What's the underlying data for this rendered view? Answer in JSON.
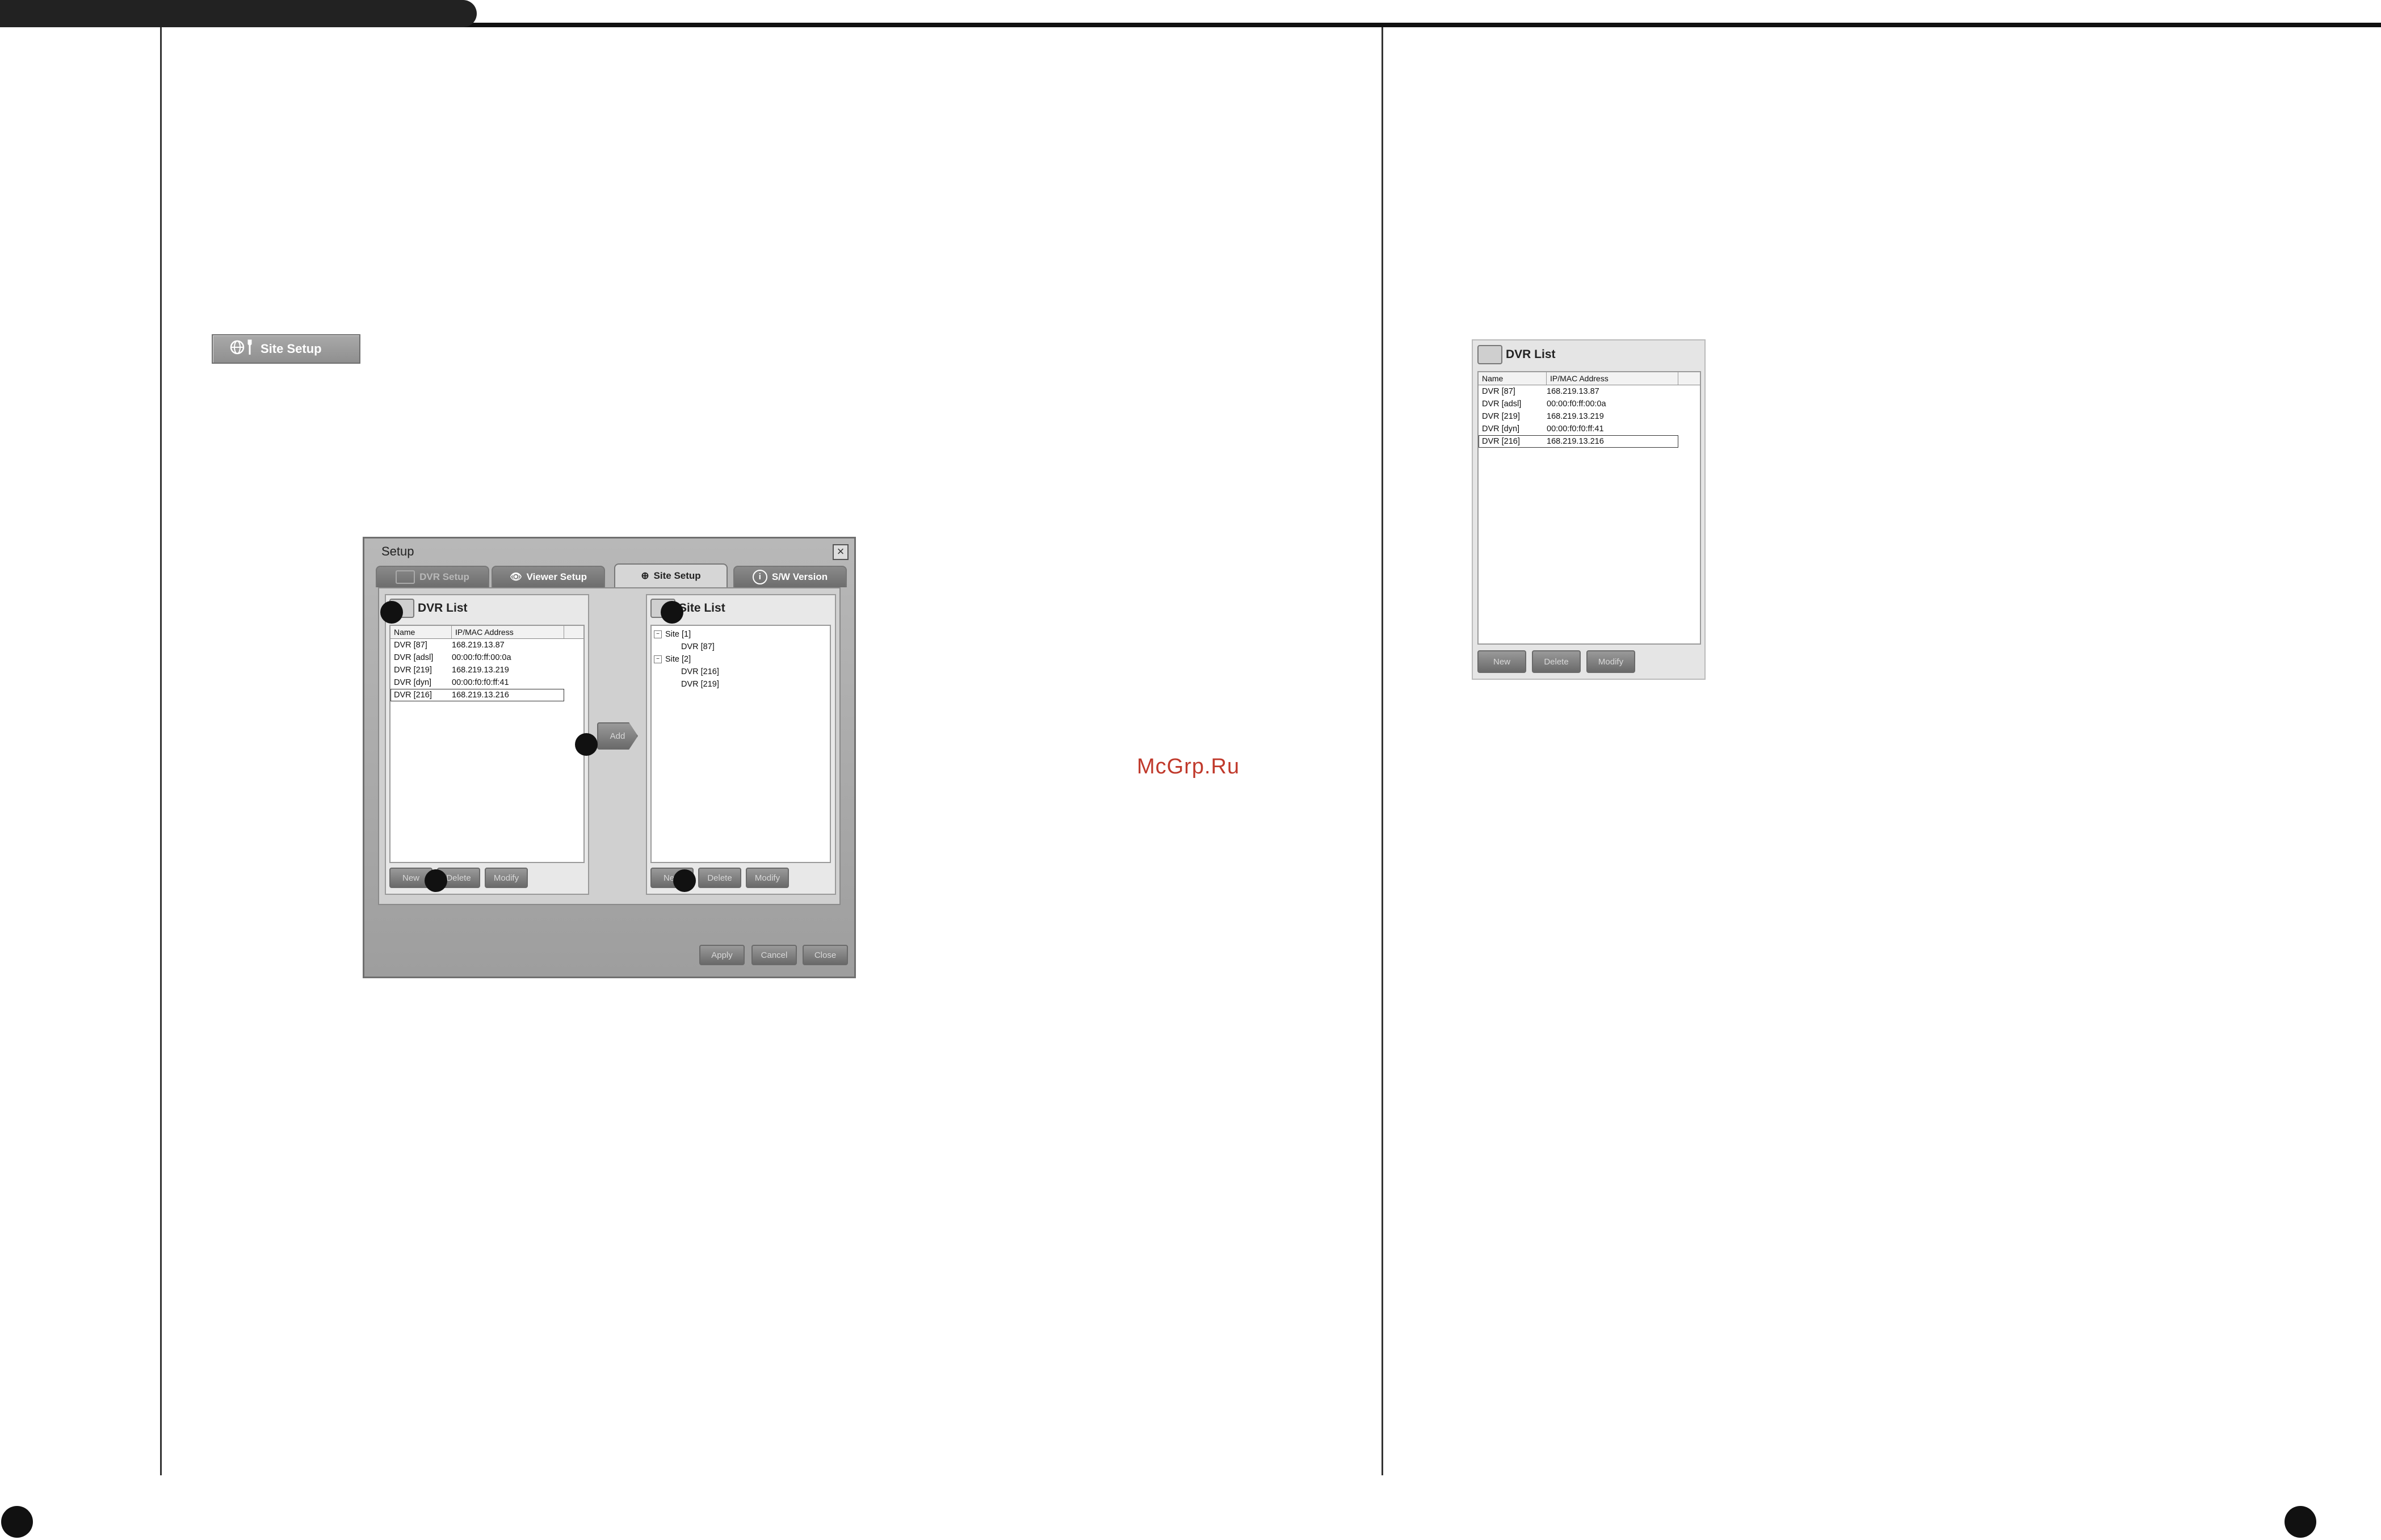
{
  "site_setup_button": {
    "label": "Site Setup",
    "icon": "globe-wrench-icon"
  },
  "dialog": {
    "title": "Setup",
    "close_icon": "close-icon",
    "tabs": [
      {
        "label": "DVR Setup",
        "icon": "dvr-icon",
        "state": "disabled"
      },
      {
        "label": "Viewer Setup",
        "icon": "eye-wrench-icon",
        "state": "normal"
      },
      {
        "label": "Site Setup",
        "icon": "globe-wrench-icon",
        "state": "active"
      },
      {
        "label": "S/W Version",
        "icon": "info-icon",
        "state": "normal"
      }
    ],
    "dvr_list": {
      "title": "DVR List",
      "columns": [
        "Name",
        "IP/MAC Address"
      ],
      "rows": [
        {
          "name": "DVR [87]",
          "address": "168.219.13.87"
        },
        {
          "name": "DVR [adsl]",
          "address": "00:00:f0:ff:00:0a"
        },
        {
          "name": "DVR [219]",
          "address": "168.219.13.219"
        },
        {
          "name": "DVR [dyn]",
          "address": "00:00:f0:f0:ff:41"
        },
        {
          "name": "DVR [216]",
          "address": "168.219.13.216"
        }
      ],
      "buttons": {
        "new": "New",
        "delete": "Delete",
        "modify": "Modify"
      }
    },
    "add_button": "Add",
    "site_list": {
      "title": "Site List",
      "tree": [
        {
          "label": "Site [1]",
          "children": [
            "DVR [87]"
          ]
        },
        {
          "label": "Site [2]",
          "children": [
            "DVR [216]",
            "DVR [219]"
          ]
        }
      ],
      "buttons": {
        "new": "New",
        "delete": "Delete",
        "modify": "Modify"
      }
    },
    "footer_buttons": {
      "apply": "Apply",
      "cancel": "Cancel",
      "close": "Close"
    }
  },
  "dvr_list_detail": {
    "title": "DVR List",
    "columns": [
      "Name",
      "IP/MAC Address"
    ],
    "rows": [
      {
        "name": "DVR [87]",
        "address": "168.219.13.87"
      },
      {
        "name": "DVR [adsl]",
        "address": "00:00:f0:ff:00:0a"
      },
      {
        "name": "DVR [219]",
        "address": "168.219.13.219"
      },
      {
        "name": "DVR [dyn]",
        "address": "00:00:f0:f0:ff:41"
      },
      {
        "name": "DVR [216]",
        "address": "168.219.13.216"
      }
    ],
    "buttons": {
      "new": "New",
      "delete": "Delete",
      "modify": "Modify"
    }
  },
  "watermark": "McGrp.Ru"
}
